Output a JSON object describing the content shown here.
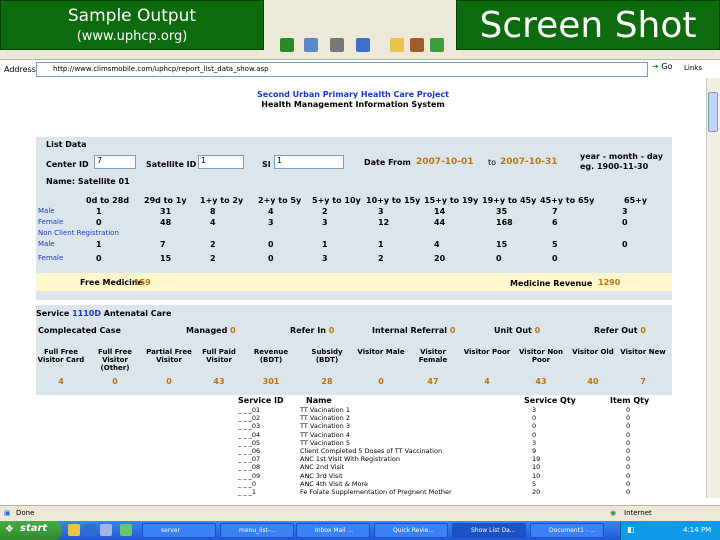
{
  "banner": {
    "left_title": "Sample Output",
    "left_url": "(www.uphcp.org)",
    "right_title": "Screen Shot"
  },
  "browser": {
    "address_label": "Address",
    "address_url": "http://www.climsmobile.com/uphcp/report_list_data_show.asp",
    "go_label": "Go",
    "links_label": "Links",
    "status_done": "Done",
    "status_zone": "Internet"
  },
  "report": {
    "project_title": "Second Urban Primary Health Care Project",
    "system_title": "Health Management Information System",
    "list_data_label": "List Data",
    "center_id_label": "Center ID",
    "center_id_value": "7",
    "satellite_id_label": "Satellite ID",
    "satellite_id_value": "1",
    "sl_label": "Sl",
    "sl_value": "1",
    "date_from_label": "Date From",
    "date_from_value": "2007-10-01",
    "to_label": "to",
    "to_value": "2007-10-31",
    "date_format_note": "year - month - day",
    "date_example_note": "eg. 1900-11-30",
    "name_label": "Name: Satellite 01",
    "age_headers": [
      "0d to 28d",
      "29d to 1y",
      "1+y to 2y",
      "2+y to 5y",
      "5+y to 10y",
      "10+y to 15y",
      "15+y to 19y",
      "19+y to 45y",
      "45+y to 65y",
      "65+y"
    ],
    "row_labels": [
      "Male",
      "Female",
      "Non Client Registration",
      "Male",
      "Female"
    ],
    "rows": [
      [
        "1",
        "31",
        "8",
        "4",
        "2",
        "3",
        "14",
        "35",
        "7",
        "3"
      ],
      [
        "0",
        "48",
        "4",
        "3",
        "3",
        "12",
        "44",
        "168",
        "6",
        "0"
      ],
      [
        "1",
        "7",
        "2",
        "0",
        "1",
        "1",
        "4",
        "15",
        "5",
        "0"
      ],
      [
        "0",
        "15",
        "2",
        "0",
        "3",
        "2",
        "20",
        "0",
        "0",
        ""
      ]
    ],
    "free_medicine_label": "Free Medicine",
    "free_medicine_value": "159",
    "medicine_revenue_label": "Medicine Revenue",
    "medicine_revenue_value": "1290",
    "service_label": "Service",
    "service_code": "1110D",
    "service_name": "Antenatal Care",
    "complicated_case_label": "Complecated Case",
    "managed_label": "Managed",
    "managed_value": "0",
    "refer_in_label": "Refer In",
    "refer_in_value": "0",
    "internal_referral_label": "Internal Referral",
    "internal_referral_value": "0",
    "unit_out_label": "Unit Out",
    "unit_out_value": "0",
    "refer_out_label": "Refer Out",
    "refer_out_value": "0",
    "visitor_headers": [
      "Full Free Visitor Card",
      "Full Free Visitor (Other)",
      "Partial Free Visitor",
      "Full Paid Visitor",
      "Revenue (BDT)",
      "Subsidy (BDT)",
      "Visitor Male",
      "Visitor Female",
      "Visitor Poor",
      "Visitor Non Poor",
      "Visitor Old",
      "Visitor New"
    ],
    "visitor_values": [
      "4",
      "0",
      "0",
      "43",
      "301",
      "28",
      "0",
      "47",
      "4",
      "43",
      "40",
      "7"
    ],
    "svc_table_headers": [
      "Service ID",
      "Name",
      "Service Qty",
      "Item Qty"
    ],
    "svc_table_rows": [
      [
        "_ _ _01",
        "TT Vacination 1",
        "3",
        "0"
      ],
      [
        "_ _ _02",
        "TT Vacination 2",
        "0",
        "0"
      ],
      [
        "_ _ _03",
        "TT Vacination 3",
        "0",
        "0"
      ],
      [
        "_ _ _04",
        "TT Vacination 4",
        "0",
        "0"
      ],
      [
        "_ _ _05",
        "TT Vacination 5",
        "3",
        "0"
      ],
      [
        "_ _ _06",
        "Client Completed 5 Doses of TT Vaccination",
        "9",
        "0"
      ],
      [
        "_ _ _07",
        "ANC 1st Visit With Registration",
        "19",
        "0"
      ],
      [
        "_ _ _08",
        "ANC 2nd Visit",
        "10",
        "0"
      ],
      [
        "_ _ _09",
        "ANC 3rd Visit",
        "10",
        "0"
      ],
      [
        "_ _ _0",
        "ANC 4th Visit & More",
        "5",
        "0"
      ],
      [
        "_ _ _1",
        "Fe Folate Supplementation of Pregnent Mother",
        "20",
        "0"
      ]
    ]
  },
  "taskbar": {
    "start_label": "start",
    "items": [
      "server",
      "menu_list-...",
      "Inbox Mail ...",
      "Quick Revie...",
      "Show List Da...",
      "Document1 - ..."
    ],
    "clock": "4:14 PM"
  },
  "colors": {
    "banner_green": "#0d6b0d",
    "link_blue": "#1a37c8",
    "value_orange": "#c0720b",
    "panel_bg": "#dbe6ec",
    "highlight_row": "#fff7cc"
  }
}
